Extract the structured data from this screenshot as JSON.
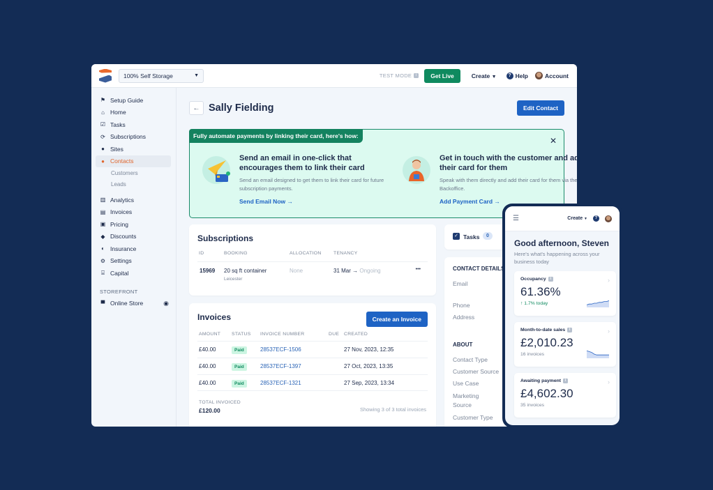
{
  "topbar": {
    "site_select": "100% Self Storage",
    "test_mode": "TEST MODE",
    "get_live": "Get Live",
    "create": "Create",
    "help": "Help",
    "account": "Account"
  },
  "sidebar": {
    "items": [
      {
        "label": "Setup Guide",
        "icon": "⚑"
      },
      {
        "label": "Home",
        "icon": "⌂"
      },
      {
        "label": "Tasks",
        "icon": "☑"
      },
      {
        "label": "Subscriptions",
        "icon": "⟳"
      },
      {
        "label": "Sites",
        "icon": "●"
      },
      {
        "label": "Contacts",
        "icon": "👤"
      }
    ],
    "contact_subitems": [
      "Customers",
      "Leads"
    ],
    "items2": [
      {
        "label": "Analytics",
        "icon": "▥"
      },
      {
        "label": "Invoices",
        "icon": "▤"
      },
      {
        "label": "Pricing",
        "icon": "▣"
      },
      {
        "label": "Discounts",
        "icon": "◆"
      },
      {
        "label": "Insurance",
        "icon": "◐"
      },
      {
        "label": "Settings",
        "icon": "⚙"
      },
      {
        "label": "Capital",
        "icon": "⌸"
      }
    ],
    "storefront_heading": "STOREFRONT",
    "online_store": "Online Store"
  },
  "page": {
    "title": "Sally Fielding",
    "edit_button": "Edit Contact"
  },
  "banner": {
    "heading": "Fully automate payments by linking their card, here's how:",
    "col1": {
      "title": "Send an email in one-click that encourages them to link their card",
      "desc": "Send an email designed to get them to link their card for future subscription payments.",
      "link": "Send Email Now →"
    },
    "col2": {
      "title": "Get in touch with the customer and add their card for them",
      "desc": "Speak with them directly and add their card for them via the Backoffice.",
      "link": "Add Payment Card →"
    }
  },
  "subscriptions": {
    "title": "Subscriptions",
    "headers": [
      "ID",
      "BOOKING",
      "ALLOCATION",
      "TENANCY"
    ],
    "rows": [
      {
        "id": "15969",
        "booking": "20 sq ft container",
        "location": "Leicester",
        "allocation": "None",
        "start": "31 Mar",
        "arrow": "→",
        "end": "Ongoing",
        "menu": "•••"
      }
    ]
  },
  "invoices": {
    "title": "Invoices",
    "create_button": "Create an Invoice",
    "headers": [
      "AMOUNT",
      "STATUS",
      "INVOICE NUMBER",
      "DUE",
      "CREATED"
    ],
    "rows": [
      {
        "amount": "£40.00",
        "status": "Paid",
        "number": "28537ECF-1506",
        "due": "",
        "created": "27 Nov, 2023, 12:35"
      },
      {
        "amount": "£40.00",
        "status": "Paid",
        "number": "28537ECF-1397",
        "due": "",
        "created": "27 Oct, 2023, 13:35"
      },
      {
        "amount": "£40.00",
        "status": "Paid",
        "number": "28537ECF-1321",
        "due": "",
        "created": "27 Sep, 2023, 13:34"
      }
    ],
    "total_label": "TOTAL INVOICED",
    "total_value": "£120.00",
    "showing": "Showing 3 of 3 total invoices"
  },
  "tasks": {
    "label": "Tasks",
    "count": "0"
  },
  "contact_details": {
    "heading": "CONTACT DETAILS",
    "fields": [
      "Email",
      "Phone",
      "Address"
    ],
    "about_heading": "ABOUT",
    "about_fields": [
      "Contact Type",
      "Customer Source",
      "Use Case",
      "Marketing Source",
      "Customer Type"
    ]
  },
  "mobile": {
    "create": "Create",
    "greeting": "Good afternoon, Steven",
    "subtitle": "Here's what's happening across your business today",
    "kpis": [
      {
        "label": "Occupancy",
        "value": "61.36%",
        "sub": "↑ 1.7% today",
        "trend": [
          3,
          4,
          4,
          5,
          5,
          6,
          6,
          7,
          7,
          8
        ]
      },
      {
        "label": "Month-to-date sales",
        "value": "£2,010.23",
        "sub": "16 invoices",
        "trend": [
          9,
          8,
          7,
          5,
          4,
          4,
          4,
          4,
          4,
          4
        ]
      },
      {
        "label": "Awaiting payment",
        "value": "£4,602.30",
        "sub": "35 invoices"
      }
    ]
  },
  "colors": {
    "brand_orange": "#e0652b",
    "primary_blue": "#1e63c4",
    "success_green": "#0f8a5f",
    "navy": "#132c55"
  }
}
